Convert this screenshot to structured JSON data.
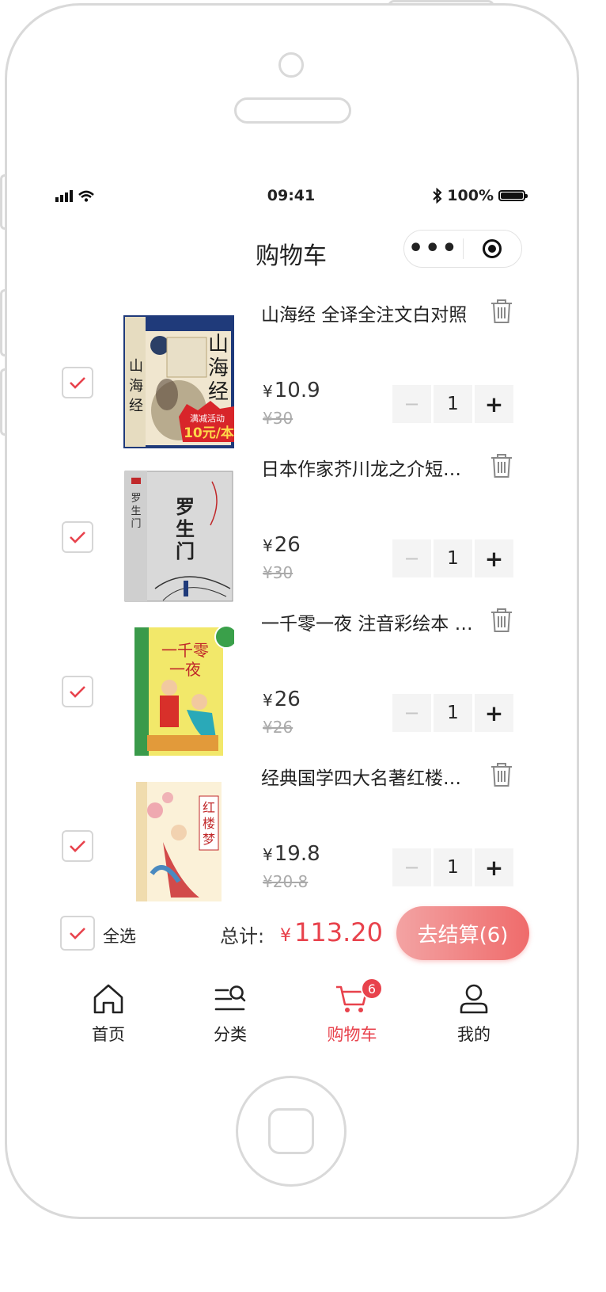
{
  "status_bar": {
    "time": "09:41",
    "battery": "100%"
  },
  "navbar": {
    "title": "购物车",
    "capsule_more": "•••"
  },
  "currency_symbol": "¥",
  "cart_items": [
    {
      "title": "山海经 全译全注文白对照",
      "price": "10.9",
      "original_price": "¥30",
      "quantity": "1",
      "checked": true,
      "cover_title": "山海经",
      "promo": "10元/本",
      "promo_top": "满减活动"
    },
    {
      "title": "日本作家芥川龙之介短…",
      "price": "26",
      "original_price": "¥30",
      "quantity": "1",
      "checked": true,
      "cover_title": "罗生门"
    },
    {
      "title": "一千零一夜 注音彩绘本 …",
      "price": "26",
      "original_price": "¥26",
      "quantity": "1",
      "checked": true,
      "cover_title": "一千零一夜"
    },
    {
      "title": "经典国学四大名著红楼…",
      "price": "19.8",
      "original_price": "¥20.8",
      "quantity": "1",
      "checked": true,
      "cover_title": "红楼梦"
    }
  ],
  "stepper": {
    "minus": "−",
    "plus": "+"
  },
  "checkout": {
    "select_all_label": "全选",
    "total_label": "总计:",
    "total_value": "113.20",
    "pay_button": "去结算(6)"
  },
  "tabbar": {
    "items": [
      {
        "label": "首页",
        "icon": "home-icon"
      },
      {
        "label": "分类",
        "icon": "category-search-icon"
      },
      {
        "label": "购物车",
        "icon": "cart-icon",
        "badge": "6",
        "active": true
      },
      {
        "label": "我的",
        "icon": "profile-icon"
      }
    ]
  },
  "colors": {
    "accent": "#e8424c",
    "pay_gradient_start": "#f3a3a3",
    "pay_gradient_end": "#ef6b6b"
  }
}
